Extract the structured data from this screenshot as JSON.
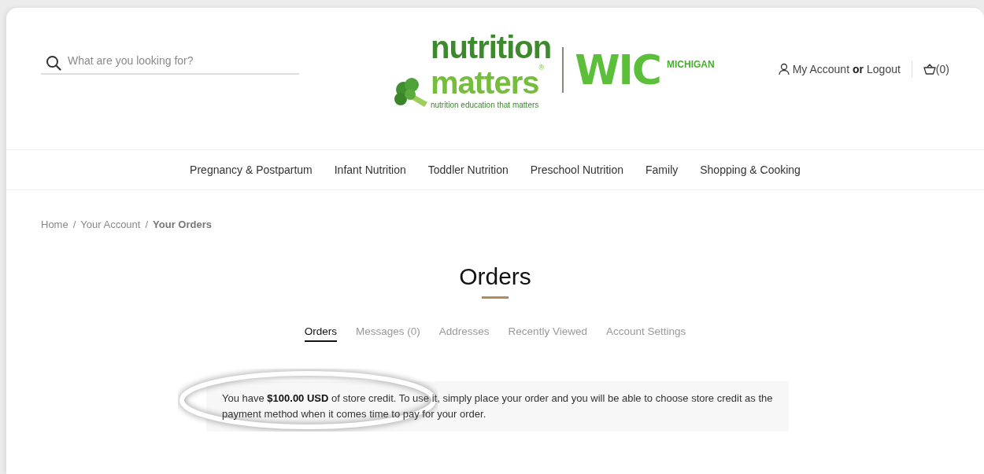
{
  "header": {
    "search": {
      "placeholder": "What are you looking for?"
    },
    "logo": {
      "word_1": "nutrition",
      "word_2": "matters",
      "mark": "®",
      "tagline": "nutrition education that matters",
      "partner": "WIC",
      "partner_region": "MICHIGAN"
    },
    "account": {
      "my_account": "My Account",
      "or": "or",
      "logout": "Logout",
      "cart_count": "(0)"
    }
  },
  "nav": [
    "Pregnancy & Postpartum",
    "Infant Nutrition",
    "Toddler Nutrition",
    "Preschool Nutrition",
    "Family",
    "Shopping & Cooking"
  ],
  "breadcrumb_separator": "/",
  "breadcrumbs": [
    {
      "label": "Home",
      "current": false
    },
    {
      "label": "Your Account",
      "current": false
    },
    {
      "label": "Your Orders",
      "current": true
    }
  ],
  "page_title": "Orders",
  "tabs": [
    {
      "label": "Orders",
      "selected": true
    },
    {
      "label": "Messages (0)",
      "selected": false
    },
    {
      "label": "Addresses",
      "selected": false
    },
    {
      "label": "Recently Viewed",
      "selected": false
    },
    {
      "label": "Account Settings",
      "selected": false
    }
  ],
  "notice": {
    "text": "You have **$100.00 USD** of store credit. To use it, simply place your order and you will be able to choose store credit as the payment method when it comes time to pay for your order.",
    "highlighted": true
  }
}
